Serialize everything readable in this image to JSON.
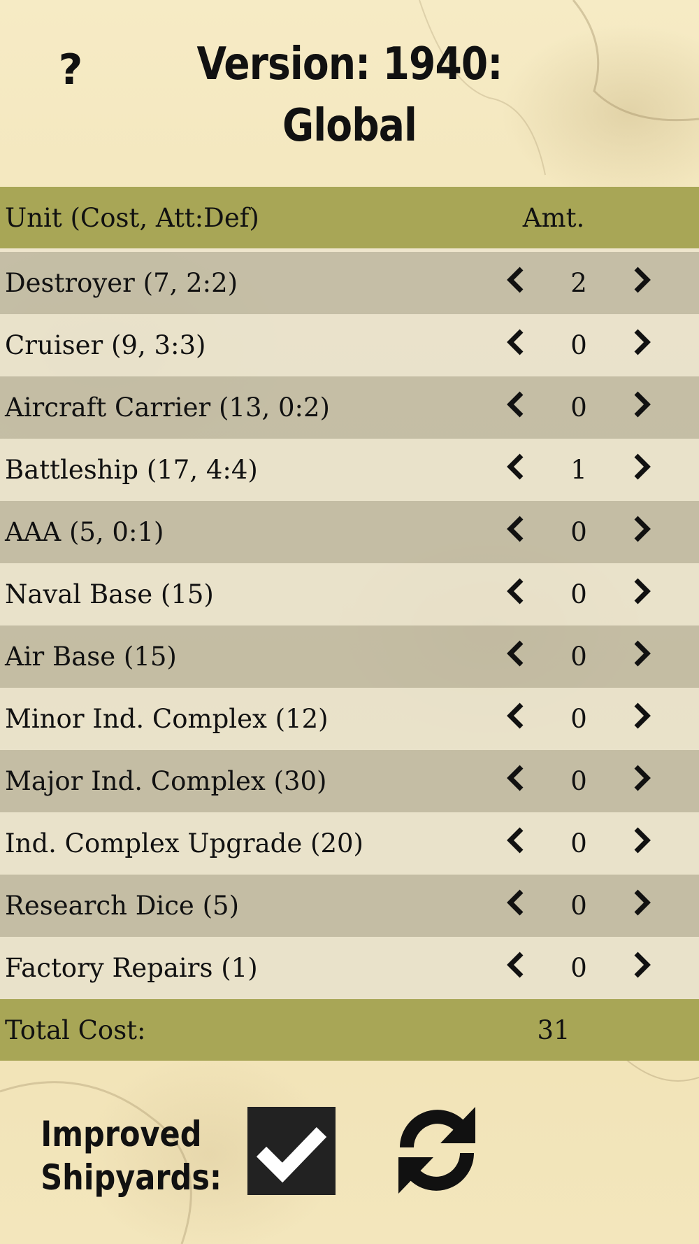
{
  "header": {
    "help_label": "?",
    "title_line1": "Version: 1940:",
    "title_line2": "Global"
  },
  "table": {
    "col_unit": "Unit (Cost, Att:Def)",
    "col_amount": "Amt.",
    "rows": [
      {
        "name": "Destroyer",
        "detail": "(7, 2:2)",
        "amount": "2"
      },
      {
        "name": "Cruiser",
        "detail": "(9, 3:3)",
        "amount": "0"
      },
      {
        "name": "Aircraft Carrier",
        "detail": "(13, 0:2)",
        "amount": "0"
      },
      {
        "name": "Battleship",
        "detail": "(17, 4:4)",
        "amount": "1"
      },
      {
        "name": "AAA",
        "detail": "(5, 0:1)",
        "amount": "0"
      },
      {
        "name": "Naval Base",
        "detail": "(15)",
        "amount": "0"
      },
      {
        "name": "Air Base",
        "detail": "(15)",
        "amount": "0"
      },
      {
        "name": "Minor Ind. Complex",
        "detail": "(12)",
        "amount": "0"
      },
      {
        "name": "Major Ind. Complex",
        "detail": "(30)",
        "amount": "0"
      },
      {
        "name": "Ind. Complex Upgrade",
        "detail": "(20)",
        "amount": "0"
      },
      {
        "name": "Research Dice",
        "detail": "(5)",
        "amount": "0"
      },
      {
        "name": "Factory Repairs",
        "detail": "(1)",
        "amount": "0"
      }
    ],
    "total_label": "Total Cost:",
    "total_value": "31"
  },
  "footer": {
    "improved_shipyards_line1": "Improved",
    "improved_shipyards_line2": "Shipyards:",
    "improved_shipyards_checked": true
  },
  "icons": {
    "help": "question-mark",
    "decrement": "chevron-left-icon",
    "increment": "chevron-right-icon",
    "checkbox": "check-icon",
    "reset": "refresh-icon"
  },
  "colors": {
    "header_bar": "#a8a656",
    "row_dark": "#b9b4a0",
    "row_light": "#e8e2ce",
    "text": "#111111"
  }
}
